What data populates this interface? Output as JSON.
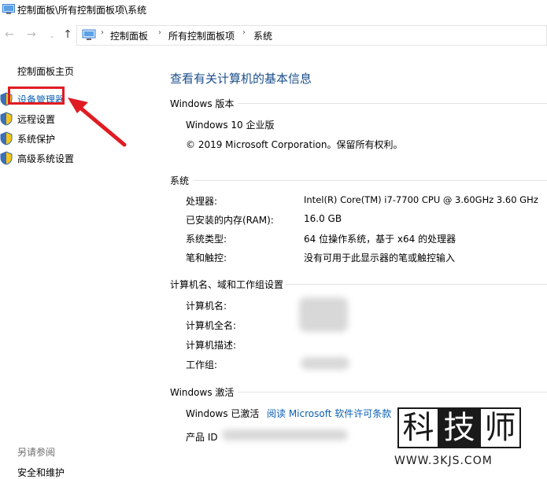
{
  "window": {
    "title": "控制面板\\所有控制面板项\\系统"
  },
  "address": {
    "crumbs": [
      "控制面板",
      "所有控制面板项",
      "系统"
    ]
  },
  "sidebar": {
    "home": "控制面板主页",
    "items": [
      {
        "label": "设备管理器"
      },
      {
        "label": "远程设置"
      },
      {
        "label": "系统保护"
      },
      {
        "label": "高级系统设置"
      }
    ],
    "see_also_title": "另请参阅",
    "see_also_link": "安全和维护"
  },
  "main": {
    "title": "查看有关计算机的基本信息",
    "edition": {
      "heading": "Windows 版本",
      "name": "Windows 10 企业版",
      "copyright": "© 2019 Microsoft Corporation。保留所有权利。"
    },
    "system": {
      "heading": "系统",
      "processor_label": "处理器:",
      "processor_value": "Intel(R) Core(TM) i7-7700 CPU @ 3.60GHz   3.60 GHz",
      "ram_label": "已安装的内存(RAM):",
      "ram_value": "16.0 GB",
      "type_label": "系统类型:",
      "type_value": "64 位操作系统，基于 x64 的处理器",
      "pen_label": "笔和触控:",
      "pen_value": "没有可用于此显示器的笔或触控输入"
    },
    "computer": {
      "heading": "计算机名、域和工作组设置",
      "name_label": "计算机名:",
      "fullname_label": "计算机全名:",
      "desc_label": "计算机描述:",
      "workgroup_label": "工作组:"
    },
    "activation": {
      "heading": "Windows 激活",
      "status": "Windows 已激活",
      "license_link": "阅读 Microsoft 软件许可条款",
      "product_id_label": "产品 ID"
    }
  },
  "watermark": {
    "chars": [
      "科",
      "技",
      "师"
    ],
    "url": "WWW.3KJS.COM"
  },
  "colors": {
    "link": "#0a5fb4",
    "title": "#1b4f8c",
    "highlight": "#e01c22"
  }
}
